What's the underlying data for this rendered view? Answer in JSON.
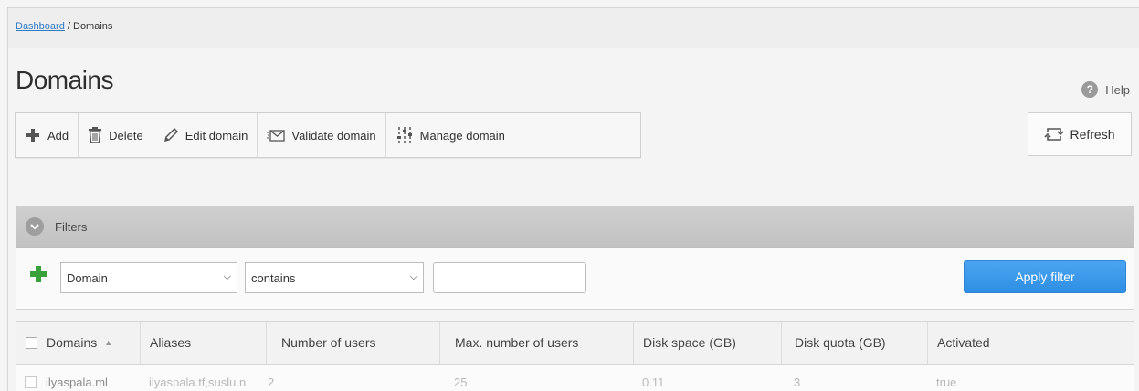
{
  "breadcrumb": {
    "root": "Dashboard",
    "separator": " / ",
    "current": "Domains"
  },
  "page": {
    "title": "Domains"
  },
  "help": {
    "label": "Help",
    "icon": "help-icon"
  },
  "toolbar": {
    "add": "Add",
    "delete": "Delete",
    "edit": "Edit domain",
    "validate": "Validate domain",
    "manage": "Manage domain"
  },
  "refresh": {
    "label": "Refresh"
  },
  "filters": {
    "title": "Filters",
    "field": "Domain",
    "operator": "contains",
    "value": "",
    "apply": "Apply filter"
  },
  "table": {
    "columns": [
      "Domains",
      "Aliases",
      "Number of users",
      "Max. number of users",
      "Disk space (GB)",
      "Disk quota (GB)",
      "Activated"
    ],
    "rows": [
      [
        "ilyaspala.ml",
        "ilyaspala.tf,suslu.n",
        "2",
        "25",
        "0.11",
        "3",
        "true"
      ]
    ]
  },
  "colors": {
    "accent": "#2f8fe4",
    "link": "#2f7ac4",
    "add_green": "#3aa13a"
  }
}
